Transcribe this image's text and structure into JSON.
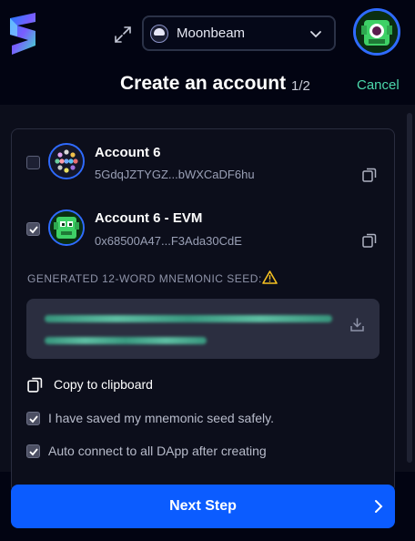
{
  "header": {
    "network": {
      "label": "Moonbeam",
      "icon": "moonbeam-network-icon"
    },
    "icons": {
      "logo": "subwallet-logo",
      "expand": "expand-icon",
      "chevron": "chevron-down-icon",
      "avatar": "account-avatar-icon"
    }
  },
  "title": {
    "text": "Create an account",
    "step": "1/2",
    "cancel_label": "Cancel"
  },
  "accounts": [
    {
      "name": "Account 6",
      "address": "5GdqJZTYGZ...bWXCaDF6hu",
      "checked": false
    },
    {
      "name": "Account 6 - EVM",
      "address": "0x68500A47...F3Ada30CdE",
      "checked": true
    }
  ],
  "seed": {
    "label": "GENERATED 12-WORD MNEMONIC SEED:",
    "icons": {
      "warning": "warning-icon",
      "download": "download-icon"
    }
  },
  "copy_label": "Copy to clipboard",
  "options": [
    {
      "label": "I have saved my mnemonic seed safely.",
      "checked": true
    },
    {
      "label": "Auto connect to all DApp after creating",
      "checked": true
    }
  ],
  "next_button": {
    "label": "Next Step"
  },
  "colors": {
    "accent": "#0b5cff",
    "cancel": "#4cd9ac",
    "warning": "#f5c022",
    "seed": "#4fdcaa"
  }
}
